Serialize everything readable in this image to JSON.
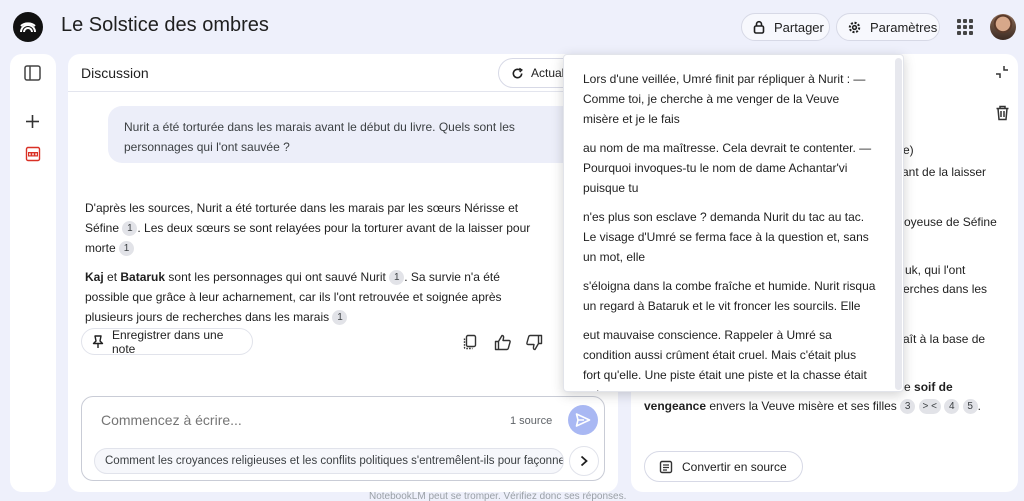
{
  "app": {
    "title": "Le Solstice des ombres",
    "share_label": "Partager",
    "settings_label": "Paramètres"
  },
  "icons": {
    "logo": "notebook-logo-icon",
    "share": "lock-icon",
    "settings": "gear-icon",
    "apps": "apps-grid-icon",
    "sidebar_toggle": "sidebar-toggle-icon",
    "add": "plus-icon",
    "pdf": "pdf-icon"
  },
  "colors": {
    "background": "#eef0fb",
    "send_button": "#a9b8f3",
    "pdf": "#d93025"
  },
  "chat": {
    "title": "Discussion",
    "refresh_label": "Actualiser",
    "question": "Nurit a été torturée dans les marais avant le début du livre. Quels sont les personnages qui l'ont sauvée ?",
    "answer_p1_a": "D'après les sources, Nurit a été torturée dans les marais par les sœurs Nérisse et Séfine",
    "answer_p1_b": ". Les deux sœurs se sont relayées pour la torturer avant de la laisser pour morte",
    "answer_p2_name1": "Kaj",
    "answer_p2_and": " et ",
    "answer_p2_name2": "Bataruk",
    "answer_p2_a": " sont les personnages qui ont sauvé Nurit",
    "answer_p2_b": ". Sa survie n'a été possible que grâce à leur acharnement, car ils l'ont retrouvée et soignée après plusieurs jours de recherches dans les marais",
    "cite_label": "1",
    "save_note_label": "Enregistrer dans une note",
    "composer_placeholder": "Commencez à écrire...",
    "source_count": "1 source",
    "suggestion": "Comment les croyances religieuses et les conflits politiques s'entremêlent-ils pour façonner le destin des personnages ?"
  },
  "notes_panel": {
    "frag_1": "e)",
    "frag_2": "ant de la laisser",
    "frag_3": "oyeuse de Séfine",
    "frag_4": "uk, qui l'ont",
    "frag_5": "erches dans les",
    "frag_6": "aît à la base de",
    "frag_7": "e ",
    "frag_7_bold": "soif de",
    "frag_8_bold": "vengeance",
    "frag_8": " envers la Veuve misère et ses filles",
    "chip_3": "3",
    "chip_mid": "> <",
    "chip_4": "4",
    "chip_5": "5",
    "chip_end": ".",
    "convert_label": "Convertir en source"
  },
  "source_popover": {
    "chunks": [
      "Lors d'une veillée, Umré finit par répliquer à Nurit : — Comme toi, je cherche à me venger de la Veuve misère et je le fais",
      "au nom de ma maîtresse. Cela devrait te contenter. — Pourquoi invoques-tu le nom de dame Achantar'vi puisque tu",
      "n'es plus son esclave ? demanda Nurit du tac au tac. Le visage d'Umré se ferma face à la question et, sans un mot, elle",
      "s'éloigna dans la combe fraîche et humide. Nurit risqua un regard à Bataruk et le vit froncer les sourcils. Elle",
      "eut mauvaise conscience. Rappeler à Umré sa condition aussi crûment était cruel. Mais c'était plus fort qu'elle. Une piste était une piste et la chasse était enivrante."
    ]
  },
  "footer": {
    "disclaimer": "NotebookLM peut se tromper. Vérifiez donc ses réponses."
  }
}
